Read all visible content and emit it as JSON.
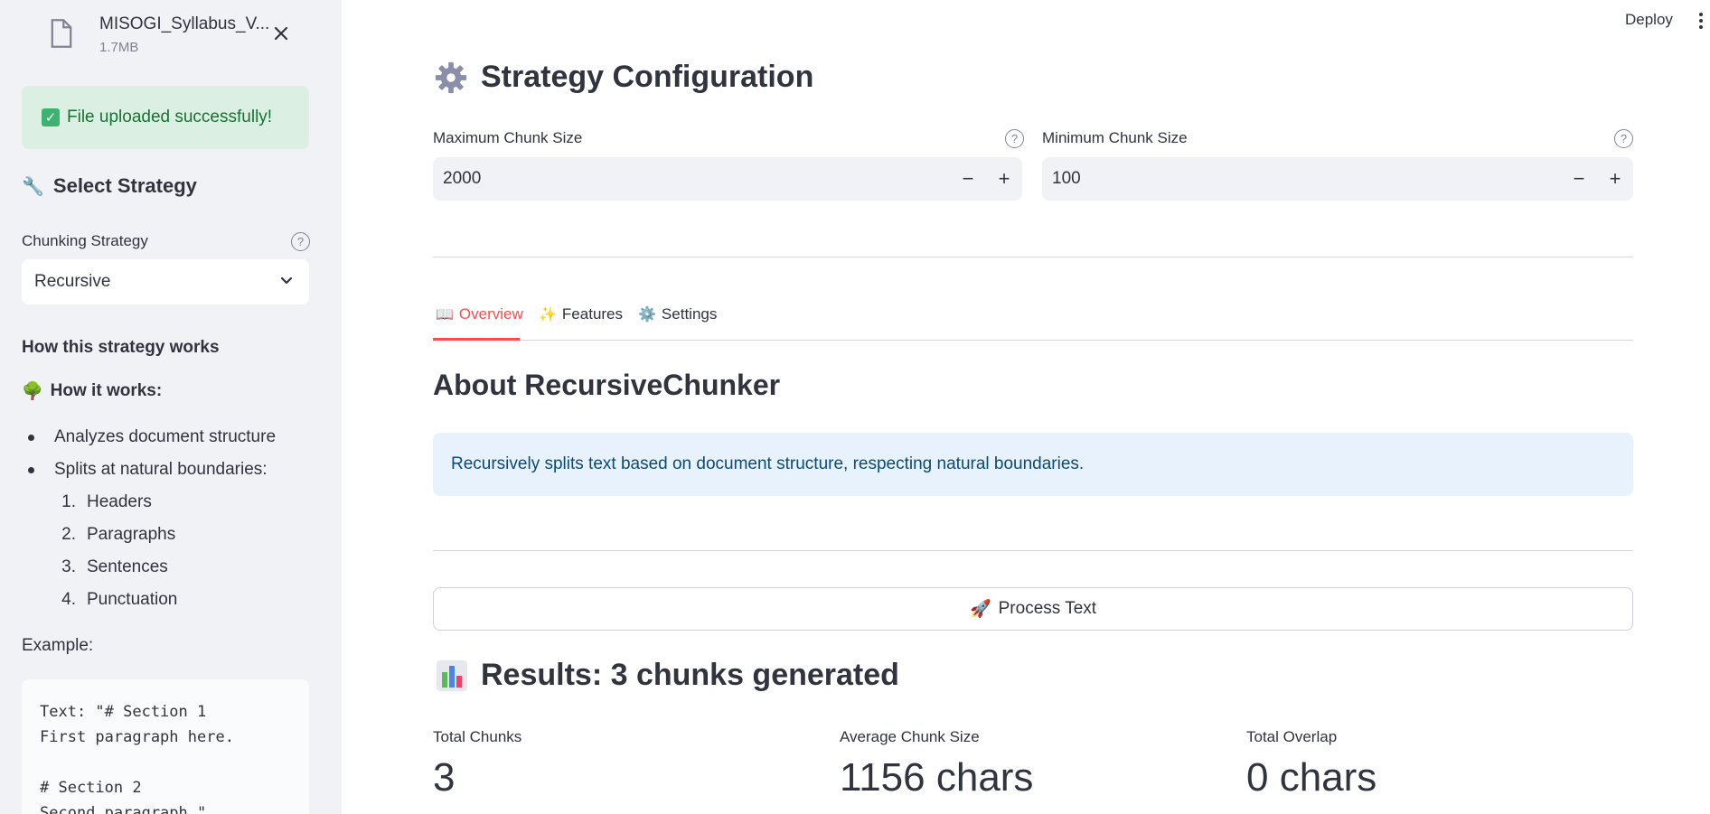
{
  "sidebar": {
    "file": {
      "name": "MISOGI_Syllabus_V...",
      "size": "1.7MB"
    },
    "success_message": "File uploaded successfully!",
    "select_strategy_heading": "Select Strategy",
    "chunking_strategy_label": "Chunking Strategy",
    "chunking_strategy_value": "Recursive",
    "how_heading": "How this strategy works",
    "how_it_works_heading": "How it works:",
    "bullets": [
      "Analyzes document structure",
      "Splits at natural boundaries:"
    ],
    "numbered": [
      {
        "num": "1.",
        "text": "Headers"
      },
      {
        "num": "2.",
        "text": "Paragraphs"
      },
      {
        "num": "3.",
        "text": "Sentences"
      },
      {
        "num": "4.",
        "text": "Punctuation"
      }
    ],
    "example_label": "Example:",
    "example_code": "Text: \"# Section 1\nFirst paragraph here.\n\n# Section 2\nSecond paragraph.\""
  },
  "header": {
    "deploy_label": "Deploy"
  },
  "config": {
    "title": "Strategy Configuration",
    "max_label": "Maximum Chunk Size",
    "max_value": "2000",
    "min_label": "Minimum Chunk Size",
    "min_value": "100"
  },
  "tabs": [
    {
      "label": "Overview",
      "icon": "book-icon"
    },
    {
      "label": "Features",
      "icon": "sparkles-icon"
    },
    {
      "label": "Settings",
      "icon": "gear-icon"
    }
  ],
  "overview": {
    "heading": "About RecursiveChunker",
    "description": "Recursively splits text based on document structure, respecting natural boundaries."
  },
  "process_button": "Process Text",
  "results": {
    "heading": "Results: 3 chunks generated",
    "metrics": [
      {
        "label": "Total Chunks",
        "value": "3"
      },
      {
        "label": "Average Chunk Size",
        "value": "1156 chars"
      },
      {
        "label": "Total Overlap",
        "value": "0 chars"
      }
    ]
  },
  "colors": {
    "accent": "#ff4b4b",
    "sidebar_bg": "#f0f2f6",
    "success_bg": "#dcefe3",
    "success_text": "#177233",
    "info_bg": "#e8f2fc",
    "info_text": "#0b4a7a"
  }
}
